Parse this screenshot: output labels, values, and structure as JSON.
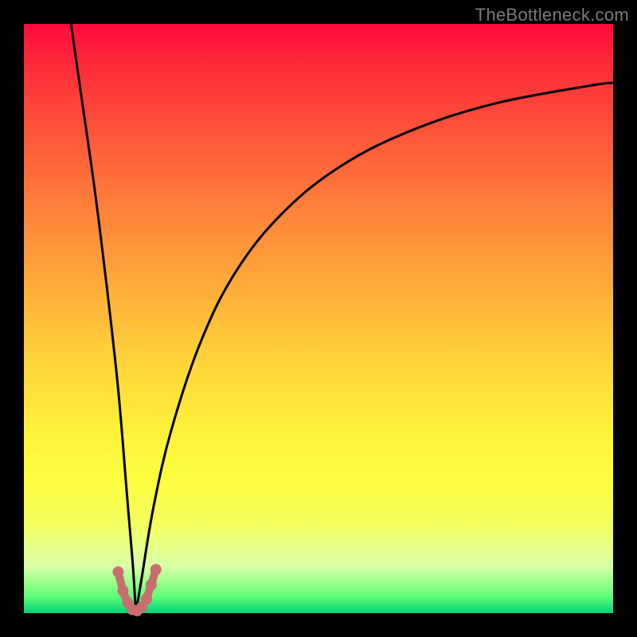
{
  "watermark": "TheBottleneck.com",
  "chart_data": {
    "type": "line",
    "title": "",
    "xlabel": "",
    "ylabel": "",
    "xlim": [
      0,
      100
    ],
    "ylim": [
      0,
      100
    ],
    "grid": false,
    "legend": false,
    "description": "Bottleneck-style V-curve over a vertical heat gradient. Left branch falls steeply from top-left to a minimum near x≈19; right branch rises as a decelerating curve toward the upper right. Short salmon marker segment at the trough.",
    "series": [
      {
        "name": "left-branch",
        "color": "#000000",
        "x": [
          8,
          10,
          12,
          14,
          16,
          17.5,
          18.5,
          19
        ],
        "y": [
          100,
          86,
          72,
          56,
          38,
          20,
          8,
          0
        ]
      },
      {
        "name": "right-branch",
        "color": "#000000",
        "x": [
          19,
          20,
          22,
          25,
          30,
          36,
          44,
          54,
          66,
          80,
          96,
          100
        ],
        "y": [
          0,
          6,
          18,
          31,
          46,
          58,
          68,
          76,
          82,
          86.5,
          89.5,
          90
        ]
      },
      {
        "name": "trough-markers",
        "color": "#c96e6e",
        "x": [
          16.0,
          16.8,
          17.6,
          18.4,
          19.2,
          20.0,
          20.8,
          21.6,
          22.4
        ],
        "y": [
          7.0,
          3.8,
          1.8,
          0.6,
          0.4,
          1.0,
          2.4,
          4.8,
          7.4
        ]
      }
    ],
    "gradient_stops": [
      {
        "pos": 0.0,
        "color": "#ff0a3a"
      },
      {
        "pos": 0.08,
        "color": "#ff2f3a"
      },
      {
        "pos": 0.2,
        "color": "#ff5a3a"
      },
      {
        "pos": 0.31,
        "color": "#ff803a"
      },
      {
        "pos": 0.45,
        "color": "#ffad3a"
      },
      {
        "pos": 0.58,
        "color": "#ffd63a"
      },
      {
        "pos": 0.7,
        "color": "#fff33a"
      },
      {
        "pos": 0.78,
        "color": "#feff40"
      },
      {
        "pos": 0.85,
        "color": "#f4ff60"
      },
      {
        "pos": 0.92,
        "color": "#daffa8"
      },
      {
        "pos": 0.97,
        "color": "#64ff78"
      },
      {
        "pos": 1.0,
        "color": "#00d278"
      }
    ]
  }
}
